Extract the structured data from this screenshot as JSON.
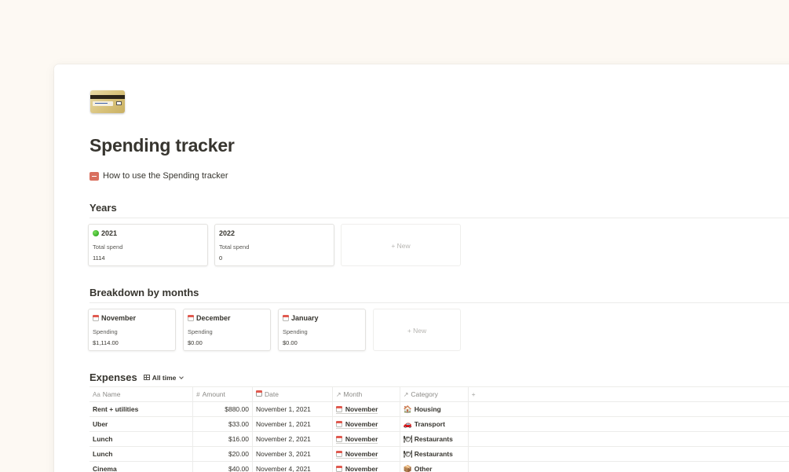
{
  "page": {
    "title": "Spending tracker",
    "icon": "credit-card-icon",
    "howto_link": "How to use the Spending tracker",
    "howto_icon": "minus-badge-icon"
  },
  "years": {
    "heading": "Years",
    "cards": [
      {
        "title": "2021",
        "icon": "green-circle-icon",
        "label": "Total spend",
        "value": "1114"
      },
      {
        "title": "2022",
        "icon": "",
        "label": "Total spend",
        "value": "0"
      }
    ],
    "new_label": "+ New"
  },
  "months": {
    "heading": "Breakdown by months",
    "cards": [
      {
        "title": "November",
        "icon": "calendar-icon",
        "label": "Spending",
        "value": "$1,114.00"
      },
      {
        "title": "December",
        "icon": "calendar-icon",
        "label": "Spending",
        "value": "$0.00"
      },
      {
        "title": "January",
        "icon": "calendar-icon",
        "label": "Spending",
        "value": "$0.00"
      }
    ],
    "new_label": "+ New"
  },
  "expenses": {
    "heading": "Expenses",
    "view_label": "All time",
    "columns": [
      {
        "label": "Name",
        "icon": "Aa"
      },
      {
        "label": "Amount",
        "icon": "#"
      },
      {
        "label": "Date",
        "icon": "calendar"
      },
      {
        "label": "Month",
        "icon": "↗"
      },
      {
        "label": "Category",
        "icon": "↗"
      }
    ],
    "add_column": "+",
    "rows": [
      {
        "name": "Rent + utilities",
        "amount": "$880.00",
        "date": "November 1, 2021",
        "month": "November",
        "category": "Housing",
        "cat_icon": "🏠"
      },
      {
        "name": "Uber",
        "amount": "$33.00",
        "date": "November 1, 2021",
        "month": "November",
        "category": "Transport",
        "cat_icon": "🚗"
      },
      {
        "name": "Lunch",
        "amount": "$16.00",
        "date": "November 2, 2021",
        "month": "November",
        "category": "Restaurants",
        "cat_icon": "🍽"
      },
      {
        "name": "Lunch",
        "amount": "$20.00",
        "date": "November 3, 2021",
        "month": "November",
        "category": "Restaurants",
        "cat_icon": "🍽"
      },
      {
        "name": "Cinema",
        "amount": "$40.00",
        "date": "November 4, 2021",
        "month": "November",
        "category": "Other",
        "cat_icon": "📦"
      }
    ]
  }
}
